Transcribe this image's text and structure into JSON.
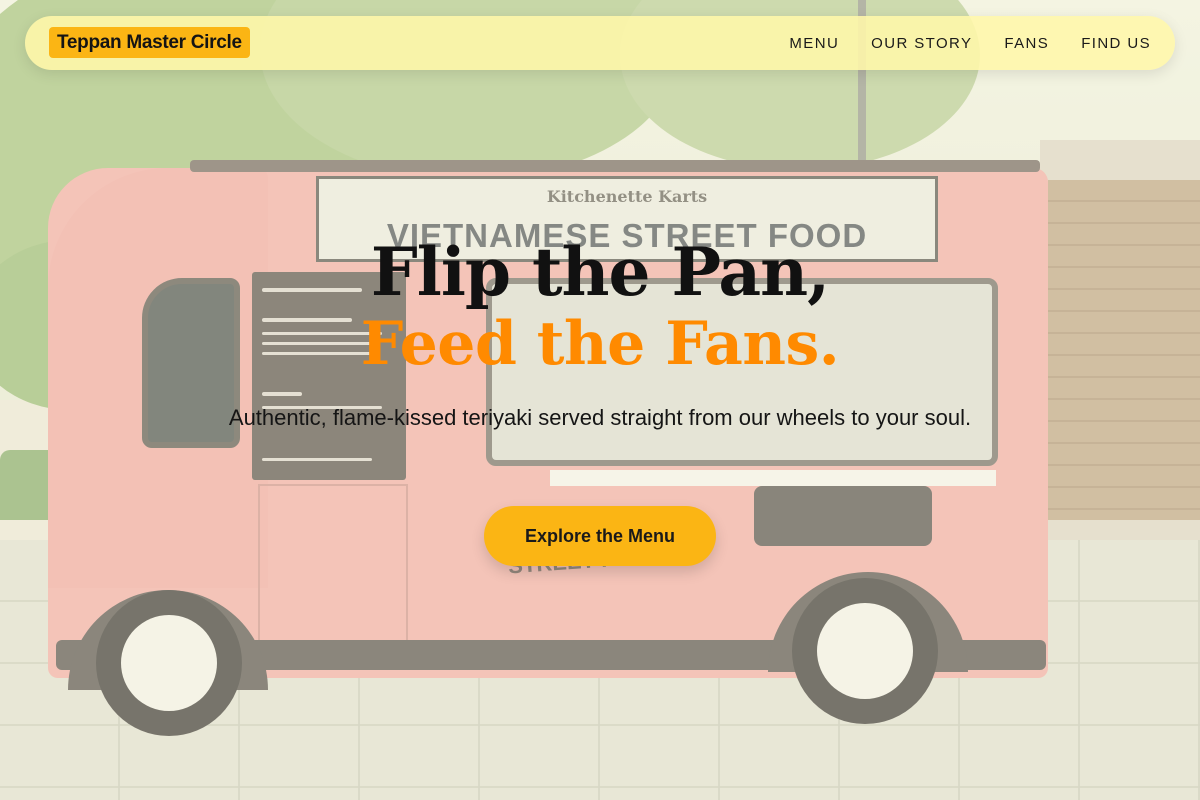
{
  "nav": {
    "brand": "Teppan Master Circle",
    "links": [
      "MENU",
      "OUR STORY",
      "FANS",
      "FIND US"
    ]
  },
  "hero": {
    "headline_line1": "Flip the Pan,",
    "headline_line2": "Feed the Fans.",
    "subtitle": "Authentic, flame-kissed teriyaki served straight from our wheels to your soul.",
    "cta_label": "Explore the Menu"
  },
  "photo": {
    "sign_small": "Kitchenette Karts",
    "sign_big": "VIETNAMESE STREET FOOD",
    "side_text": "STREET FOOD"
  },
  "colors": {
    "accent": "#fbb514",
    "headline_highlight": "#ff8a00",
    "nav_background": "#fff7aa",
    "truck_pink": "#eea6a2"
  }
}
